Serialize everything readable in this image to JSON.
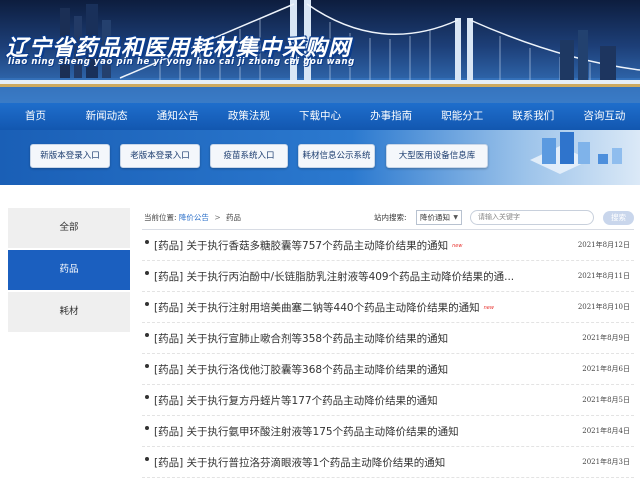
{
  "site": {
    "title": "辽宁省药品和医用耗材集中采购网",
    "pinyin": "liao ning sheng yao pin he yi yong hao cai ji zhong cai gou wang"
  },
  "nav": [
    "首页",
    "新闻动态",
    "通知公告",
    "政策法规",
    "下载中心",
    "办事指南",
    "职能分工",
    "联系我们",
    "咨询互动"
  ],
  "quick_links": [
    "新版本登录入口",
    "老版本登录入口",
    "疫苗系统入口",
    "耗材信息公示系统",
    "大型医用设备信息库"
  ],
  "sidebar": [
    "全部",
    "药品",
    "耗材"
  ],
  "breadcrumb": {
    "label": "当前位置:",
    "items": [
      "降价公告",
      "药品"
    ]
  },
  "search": {
    "label": "站内搜索:",
    "select_value": "降价通知",
    "placeholder": "请输入关键字",
    "button": "搜索"
  },
  "news": [
    {
      "title": "[药品] 关于执行香菇多糖胶囊等757个药品主动降价结果的通知",
      "date": "2021年8月12日",
      "tag": "new"
    },
    {
      "title": "[药品] 关于执行丙泊酚中/长链脂肪乳注射液等409个药品主动降价结果的通...",
      "date": "2021年8月11日",
      "tag": ""
    },
    {
      "title": "[药品] 关于执行注射用培美曲塞二钠等440个药品主动降价结果的通知",
      "date": "2021年8月10日",
      "tag": "new"
    },
    {
      "title": "[药品] 关于执行宣肺止嗽合剂等358个药品主动降价结果的通知",
      "date": "2021年8月9日",
      "tag": ""
    },
    {
      "title": "[药品] 关于执行洛伐他汀胶囊等368个药品主动降价结果的通知",
      "date": "2021年8月6日",
      "tag": ""
    },
    {
      "title": "[药品] 关于执行复方丹蛭片等177个药品主动降价结果的通知",
      "date": "2021年8月5日",
      "tag": ""
    },
    {
      "title": "[药品] 关于执行氨甲环酸注射液等175个药品主动降价结果的通知",
      "date": "2021年8月4日",
      "tag": ""
    },
    {
      "title": "[药品] 关于执行普拉洛芬滴眼液等1个药品主动降价结果的通知",
      "date": "2021年8月3日",
      "tag": ""
    }
  ],
  "colors": {
    "nav_blue": "#1257b0",
    "sidebar_active": "#1b5fbf",
    "new_tag": "#e8322e"
  }
}
